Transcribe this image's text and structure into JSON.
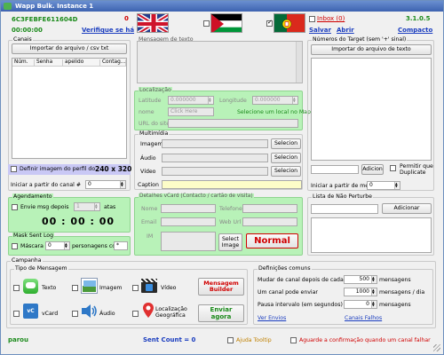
{
  "window": {
    "title": "Wapp Bulk. Instance 1"
  },
  "header": {
    "instance_id": "6C3FEBFE611604D",
    "count": "0",
    "timer": "00:00:00",
    "verify_link": "Verifique se há",
    "inbox_label": "Inbox (0)",
    "version": "3.1.0.5",
    "save_link": "Salvar",
    "open_link": "Abrir",
    "compact_link": "Compacto"
  },
  "channels": {
    "legend": "Canais",
    "import_button": "Importar do arquivo / csv txt",
    "columns": [
      "Núm.",
      "Senha",
      "apelido",
      "Contag..."
    ],
    "profile_image_label": "Definir imagem do perfil do",
    "profile_size": "240 x 320",
    "start_label": "Iniciar a partir do canal #",
    "start_value": "0"
  },
  "message": {
    "legend": "Mensagem de texto"
  },
  "location": {
    "legend": "Localização",
    "lat_label": "Latitude",
    "lat_value": "0.000000",
    "lng_label": "Longitude",
    "lng_value": "0.000000",
    "name_label": "nome",
    "name_placeholder": "Click Here",
    "select_map_link": "Selecione um local no Map",
    "url_label": "URL do site"
  },
  "multimedia": {
    "legend": "Multimídia",
    "image_label": "Imagem",
    "audio_label": "Áudio",
    "video_label": "Vídeo",
    "select_button": "Selecion",
    "caption_label": "Caption"
  },
  "vcard": {
    "legend": "Detalhes vCard (Contacto / cartão de visita)",
    "name_label": "Nome",
    "phone_label": "Telefone",
    "email_label": "Email",
    "weburl_label": "Web Url",
    "im_label": "IM",
    "select_image_button": "Select Image",
    "normal_button": "Normal"
  },
  "targets": {
    "legend": "Números do Target (sem '+' sinal)",
    "import_button": "Importar do arquivo de texto",
    "add_button": "Adicion",
    "duplicate_label": "Permitir que Duplicate",
    "start_label": "Iniciar a partir de meta #",
    "start_value": "0"
  },
  "scheduling": {
    "legend": "Agendamento",
    "send_after_label": "Envie msg depois",
    "send_after_value": "1",
    "unit": "atas",
    "countdown": "00 : 00 : 00"
  },
  "masklog": {
    "legend": "Mask Sent Log",
    "mask_label": "Máscara",
    "mask_value": "0",
    "persons_label": "personagens con",
    "char_value": "*"
  },
  "blacklist": {
    "legend": "Lista de Não Perturbe",
    "add_button": "Adicionar"
  },
  "campaign": {
    "legend": "Campanha",
    "types_legend": "Tipo de Mensagem",
    "text_label": "Texto",
    "image_label": "Imagem",
    "video_label": "Vídeo",
    "vcard_label": "vCard",
    "audio_label": "Áudio",
    "geo_label": "Localização Geográfica",
    "builder_button": "Mensagem Builder",
    "send_button": "Enviar agora"
  },
  "settings": {
    "legend": "Definições comuns",
    "change_label": "Mudar de canal depois de cada",
    "change_value": "500",
    "change_unit": "mensagens",
    "send_label": "Um canal pode enviar",
    "send_value": "1000",
    "send_unit": "mensagens / dia",
    "pause_label": "Pausa intervalo (em segundos)",
    "pause_value": "0",
    "pause_unit": "mensagens",
    "sent_link": "Ver Envios",
    "failed_link": "Canais Falhos"
  },
  "footer": {
    "status": "parou",
    "sent_count": "Sent Count = 0",
    "tooltip_label": "Ajuda Tooltip",
    "wait_label": "Aguarde a confirmação quando um canal falhar"
  }
}
